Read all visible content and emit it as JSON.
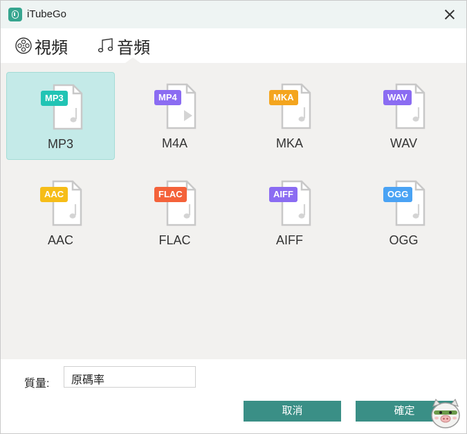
{
  "window": {
    "title": "iTubeGo"
  },
  "tabs": [
    {
      "label": "視頻",
      "icon": "film-reel-icon"
    },
    {
      "label": "音頻",
      "icon": "music-notes-icon",
      "active": true
    }
  ],
  "formats": [
    {
      "badge": "MP3",
      "label": "MP3",
      "color": "#21c4b4",
      "selected": true,
      "glyph": "music-note"
    },
    {
      "badge": "MP4",
      "label": "M4A",
      "color": "#8b6cf2",
      "glyph": "play"
    },
    {
      "badge": "MKA",
      "label": "MKA",
      "color": "#f4a51e",
      "glyph": "music-note"
    },
    {
      "badge": "WAV",
      "label": "WAV",
      "color": "#8b6cf2",
      "glyph": "music-note"
    },
    {
      "badge": "AAC",
      "label": "AAC",
      "color": "#f6bd18",
      "glyph": "music-note"
    },
    {
      "badge": "FLAC",
      "label": "FLAC",
      "color": "#f4623a",
      "glyph": "music-note"
    },
    {
      "badge": "AIFF",
      "label": "AIFF",
      "color": "#8b6cf2",
      "glyph": "music-note"
    },
    {
      "badge": "OGG",
      "label": "OGG",
      "color": "#4aa3f4",
      "glyph": "music-note"
    }
  ],
  "quality": {
    "label": "質量:",
    "value": "原碼率"
  },
  "buttons": {
    "cancel": "取消",
    "ok": "確定"
  },
  "colors": {
    "accent": "#3a8f86",
    "selected_bg": "#c4eae8",
    "panel_bg": "#f2f1ef"
  }
}
